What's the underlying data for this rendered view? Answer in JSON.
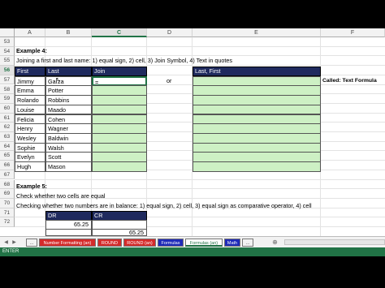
{
  "columns": [
    "A",
    "B",
    "C",
    "D",
    "E",
    "F"
  ],
  "selected_column": "C",
  "rows": [
    "53",
    "54",
    "55",
    "56",
    "57",
    "58",
    "59",
    "60",
    "61",
    "62",
    "63",
    "64",
    "65",
    "66",
    "67",
    "68",
    "69",
    "70",
    "71",
    "72"
  ],
  "selected_row": "56",
  "section4": {
    "title": "Example 4:",
    "description": "Joining a first and last name: 1) equal sign, 2) cell, 3) Join Symbol, 4) Text in quotes",
    "headers": {
      "first": "First",
      "last": "Last",
      "join": "Join",
      "last_first": "Last, First"
    },
    "or_label": "or",
    "called_label": "Called: Text Formula",
    "active_cell_value": "=",
    "names": [
      {
        "first": "Jimmy",
        "last": "Garza"
      },
      {
        "first": "Emma",
        "last": "Potter"
      },
      {
        "first": "Rolando",
        "last": "Robbins"
      },
      {
        "first": "Louise",
        "last": "Maado"
      },
      {
        "first": "Felicia",
        "last": "Cohen"
      },
      {
        "first": "Henry",
        "last": "Wagner"
      },
      {
        "first": "Wesley",
        "last": "Baldwin"
      },
      {
        "first": "Sophie",
        "last": "Walsh"
      },
      {
        "first": "Evelyn",
        "last": "Scott"
      },
      {
        "first": "Hugh",
        "last": "Mason"
      }
    ]
  },
  "section5": {
    "title": "Example 5:",
    "line1": "Check whether two cells are equal",
    "line2": "Checking whether two numbers are in balance: 1) equal sign, 2) cell, 3) equal sign as comparative operator, 4) cell",
    "headers": {
      "dr": "DR",
      "cr": "CR"
    },
    "dr_value": "65.25",
    "cr_value": "65.25"
  },
  "tabs": [
    {
      "label": "...",
      "color": "#f2f2f2"
    },
    {
      "label": "Number Formatting (an)",
      "color": "#d42b2b"
    },
    {
      "label": "ROUND",
      "color": "#d42b2b"
    },
    {
      "label": "ROUND (an)",
      "color": "#d42b2b"
    },
    {
      "label": "Formulas",
      "color": "#1f2ab8"
    },
    {
      "label": "Formulas (an)",
      "color": "#f2f2f2"
    },
    {
      "label": "Math",
      "color": "#1f2ab8"
    },
    {
      "label": "...",
      "color": "#f2f2f2"
    }
  ],
  "status_text": "ENTER"
}
